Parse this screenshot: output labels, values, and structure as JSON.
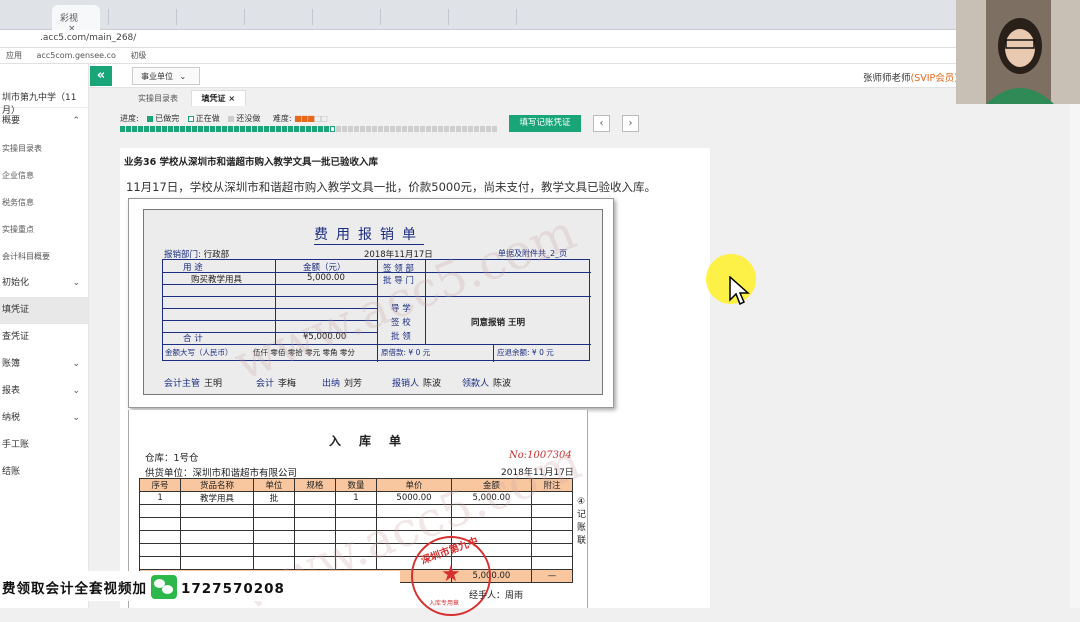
{
  "browser": {
    "tab_active": "彩视",
    "url": ".acc5.com/main_268/",
    "bookmarks": [
      "应用",
      "acc5com.gensee.co",
      "初级"
    ]
  },
  "header": {
    "department_select": "事业单位",
    "user_name": "张师师老师",
    "user_vip": "(SVIP会员)"
  },
  "sidebar": {
    "school": "圳市第九中学（11月）",
    "items": [
      {
        "label": "概要",
        "chevron": "up"
      },
      {
        "label": "实操目录表",
        "sub": true
      },
      {
        "label": "企业信息",
        "sub": true
      },
      {
        "label": "税务信息",
        "sub": true
      },
      {
        "label": "实操重点",
        "sub": true
      },
      {
        "label": "会计科目概要",
        "sub": true
      },
      {
        "label": "初始化",
        "chevron": "down"
      },
      {
        "label": "填凭证",
        "active": true
      },
      {
        "label": "查凭证"
      },
      {
        "label": "账簿",
        "chevron": "down"
      },
      {
        "label": "报表",
        "chevron": "down"
      },
      {
        "label": "纳税",
        "chevron": "down"
      },
      {
        "label": "手工账"
      },
      {
        "label": "结账"
      }
    ]
  },
  "page_tabs": [
    {
      "label": "实操目录表"
    },
    {
      "label": "填凭证",
      "close": "×"
    }
  ],
  "progress": {
    "label": "进度:",
    "done": "已做完",
    "doing": "正在做",
    "todo": "还没做",
    "difficulty_label": "难度:",
    "difficulty_stars": 3,
    "difficulty_max": 5,
    "cells_done": 35,
    "cells_total": 63
  },
  "actions": {
    "fill_voucher": "填写记账凭证",
    "prev": "‹",
    "next": "›"
  },
  "business": {
    "title": "业务36 学校从深圳市和谐超市购入教学文具一批已验收入库",
    "description": "11月17日，学校从深圳市和谐超市购入教学文具一批，价款5000元，尚未支付，教学文具已验收入库。"
  },
  "expense_form": {
    "title": "费用报销单",
    "dept_label": "报销部门:",
    "dept": "行政部",
    "date": "2018年11月17日",
    "attach": "单据及附件共_2_页",
    "col_use": "用        途",
    "col_amount": "金额（元）",
    "row1_use": "购买教学用具",
    "row1_amount": "5,000.00",
    "approve1": "签 领 部",
    "approve2": "批 导 门",
    "approve3": "导 学",
    "approve4": "签 校",
    "approve5": "批 领",
    "approval_text": "同意报销  王明",
    "total_label": "合        计",
    "total": "¥5,000.00",
    "capital_label": "金额大写（人民币）",
    "capital_value": "伍仟 零佰 零拾 零元 零角 零分",
    "borrow": "原借款:  ¥   0    元",
    "refund": "应退余额:  ¥  0   元",
    "supervisor_label": "会计主管",
    "supervisor": "王明",
    "accountant_label": "会计",
    "accountant": "李梅",
    "cashier_label": "出纳",
    "cashier": "刘芳",
    "claimant_label": "报销人",
    "claimant": "陈波",
    "receiver_label": "领款人",
    "receiver": "陈波"
  },
  "receipt_form": {
    "title": "入库单",
    "warehouse": "仓库：1号仓",
    "number": "No:1007304",
    "supplier": "供货单位：深圳市和谐超市有限公司",
    "date": "2018年11月17日",
    "headers": [
      "序号",
      "货品名称",
      "单位",
      "规格",
      "数量",
      "单价",
      "金额",
      "附注"
    ],
    "row1": [
      "1",
      "教学用具",
      "批",
      "",
      "1",
      "5000.00",
      "5,000.00",
      ""
    ],
    "total_amount": "5,000.00",
    "total_note": "—",
    "side_label": "④记账联",
    "handler": "经手人：周雨",
    "handler2": "周雨",
    "stamp_text": "深圳市第九中",
    "stamp_sub": "入库专用章"
  },
  "watermark": "www.acc5.com",
  "banner": {
    "text": "费领取会计全套视频加",
    "phone": "1727570208"
  },
  "colors": {
    "accent": "#1aa579",
    "form_blue": "#1c2e82",
    "highlight": "#f8c7a0",
    "stamp_red": "#d83030"
  }
}
